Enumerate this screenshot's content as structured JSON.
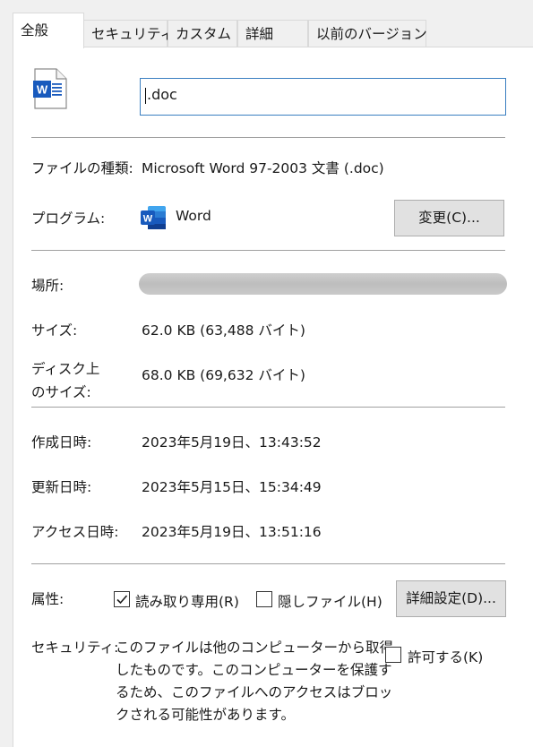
{
  "tabs": [
    {
      "label": "全般",
      "active": true
    },
    {
      "label": "セキュリティ"
    },
    {
      "label": "カスタム"
    },
    {
      "label": "詳細"
    },
    {
      "label": "以前のバージョン"
    }
  ],
  "file": {
    "icon": "word-document-icon",
    "name": ".doc"
  },
  "type": {
    "label": "ファイルの種類:",
    "value": "Microsoft Word 97-2003 文書 (.doc)"
  },
  "program": {
    "label": "プログラム:",
    "icon": "word-app-icon",
    "name": "Word",
    "change_button": "変更(C)..."
  },
  "location": {
    "label": "場所:"
  },
  "size": {
    "label": "サイズ:",
    "value": "62.0 KB (63,488 バイト)"
  },
  "size_on_disk": {
    "label_line1": "ディスク上",
    "label_line2": "のサイズ:",
    "value": "68.0 KB (69,632 バイト)"
  },
  "created": {
    "label": "作成日時:",
    "value": "2023年5月19日、13:43:52"
  },
  "modified": {
    "label": "更新日時:",
    "value": "2023年5月15日、15:34:49"
  },
  "accessed": {
    "label": "アクセス日時:",
    "value": "2023年5月19日、13:51:16"
  },
  "attributes": {
    "label": "属性:",
    "readonly_label": "読み取り専用(R)",
    "readonly_checked": true,
    "hidden_label": "隠しファイル(H)",
    "hidden_checked": false,
    "advanced_button": "詳細設定(D)..."
  },
  "security": {
    "label": "セキュリティ:",
    "text_lines": [
      "このファイルは他のコンピューターから取得",
      "したものです。このコンピューターを保護す",
      "るため、このファイルへのアクセスはブロッ",
      "クされる可能性があります。"
    ],
    "unblock_label": "許可する(K)",
    "unblock_checked": false
  },
  "colors": {
    "word_blue": "#185abd",
    "focus_border": "#3a7fc1",
    "separator": "#a0a0a0",
    "button_bg": "#e1e1e1"
  }
}
